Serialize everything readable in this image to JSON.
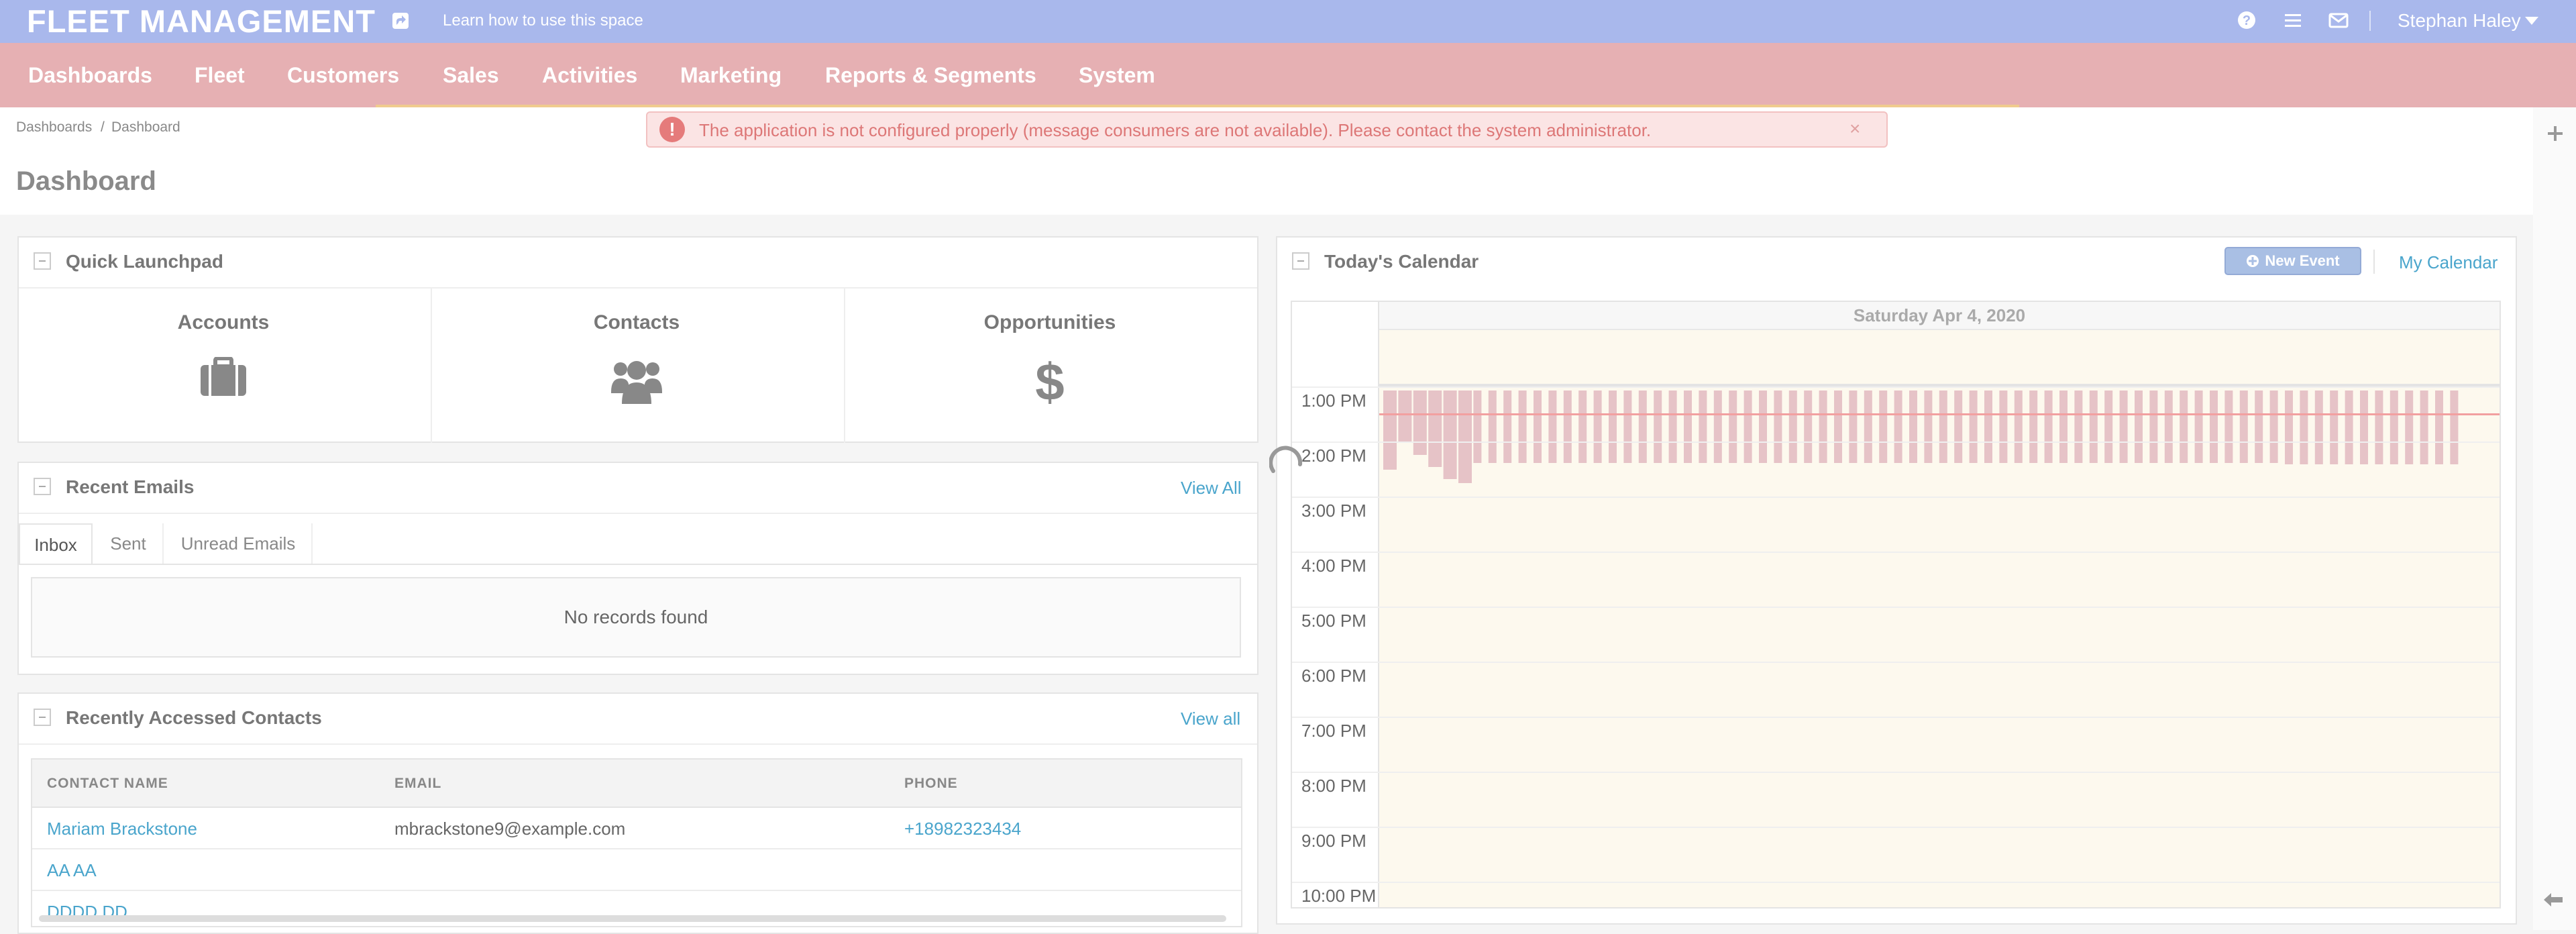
{
  "header": {
    "brand": "FLEET MANAGEMENT",
    "learn_link": "Learn how to use this space",
    "user_name": "Stephan Haley",
    "icons": [
      "share-icon",
      "help-icon",
      "menu-icon",
      "mail-icon",
      "chevron-down-icon"
    ],
    "colors": {
      "header_bg": "#a9b8ec",
      "nav_bg": "#e6b0b3"
    }
  },
  "nav": {
    "items": [
      "Dashboards",
      "Fleet",
      "Customers",
      "Sales",
      "Activities",
      "Marketing",
      "Reports & Segments",
      "System"
    ]
  },
  "breadcrumb": {
    "root": "Dashboards",
    "separator": "/",
    "current": "Dashboard"
  },
  "page": {
    "title": "Dashboard"
  },
  "alert": {
    "message": "The application is not configured properly (message consumers are not available). Please contact the system administrator.",
    "close": "×",
    "icon": "!"
  },
  "launchpad": {
    "title": "Quick Launchpad",
    "items": [
      {
        "label": "Accounts",
        "icon": "briefcase-icon"
      },
      {
        "label": "Contacts",
        "icon": "users-icon"
      },
      {
        "label": "Opportunities",
        "icon": "dollar-icon"
      }
    ]
  },
  "emails": {
    "title": "Recent Emails",
    "view_all": "View All",
    "tabs": [
      "Inbox",
      "Sent",
      "Unread Emails"
    ],
    "active_tab": "Inbox",
    "empty": "No records found"
  },
  "contacts": {
    "title": "Recently Accessed Contacts",
    "view_all": "View all",
    "columns": [
      "CONTACT NAME",
      "EMAIL",
      "PHONE"
    ],
    "rows": [
      {
        "name": "Mariam Brackstone",
        "email": "mbrackstone9@example.com",
        "phone": "+18982323434"
      },
      {
        "name": "AA AA",
        "email": "",
        "phone": ""
      },
      {
        "name": "DDDD DD",
        "email": "",
        "phone": ""
      }
    ]
  },
  "calendar": {
    "title": "Today's Calendar",
    "new_event": "New Event",
    "my_calendar": "My Calendar",
    "day": "Saturday Apr 4, 2020",
    "hours": [
      "1:00 PM",
      "2:00 PM",
      "3:00 PM",
      "4:00 PM",
      "5:00 PM",
      "6:00 PM",
      "7:00 PM",
      "8:00 PM",
      "9:00 PM",
      "10:00 PM"
    ]
  }
}
